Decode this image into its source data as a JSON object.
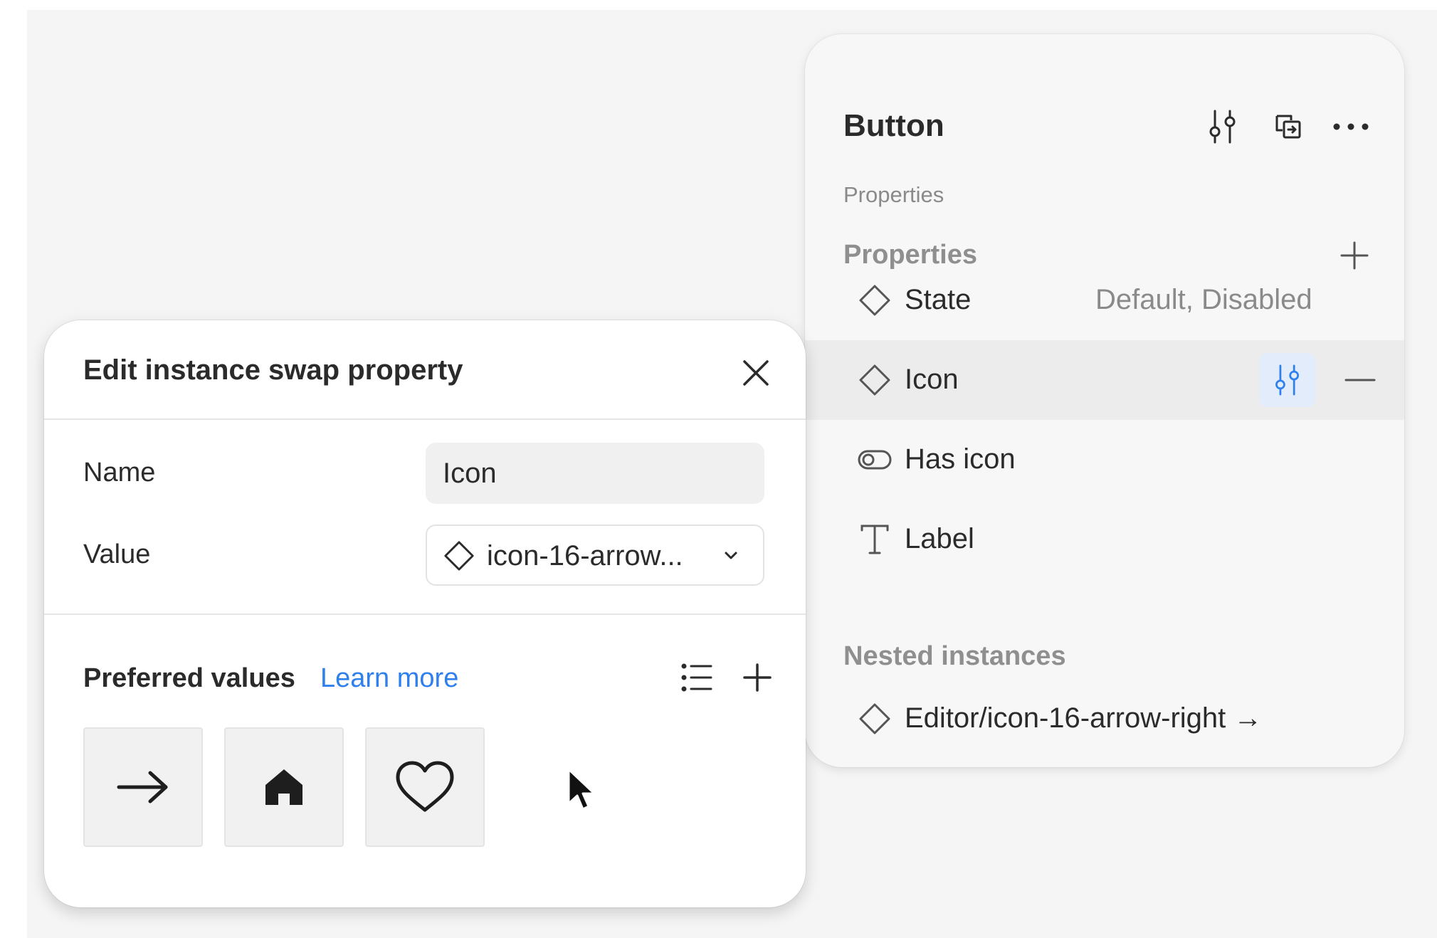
{
  "panel": {
    "title": "Button",
    "header_icons": [
      "component-properties-icon",
      "instance-swap-icon",
      "more-icon"
    ],
    "section_small": "Properties",
    "properties_label": "Properties",
    "rows": [
      {
        "icon": "variant-diamond-icon",
        "name": "State",
        "value": "Default, Disabled"
      },
      {
        "icon": "instance-diamond-icon",
        "name": "Icon",
        "value": "",
        "selected": true
      },
      {
        "icon": "boolean-toggle-icon",
        "name": "Has icon",
        "value": ""
      },
      {
        "icon": "text-type-icon",
        "name": "Label",
        "value": ""
      }
    ],
    "nested_label": "Nested instances",
    "nested_item": "Editor/icon-16-arrow-right →"
  },
  "dialog": {
    "title": "Edit instance swap property",
    "name_label": "Name",
    "name_value": "Icon",
    "value_label": "Value",
    "value_text": "icon-16-arrow...",
    "preferred_label": "Preferred values",
    "learn_more": "Learn more",
    "preferred_icons": [
      "arrow-right-icon",
      "home-icon",
      "heart-icon"
    ]
  },
  "colors": {
    "accent": "#2f80ed",
    "selected_row_bg": "#ececec",
    "settings_highlight_bg": "#e2ecfb"
  }
}
